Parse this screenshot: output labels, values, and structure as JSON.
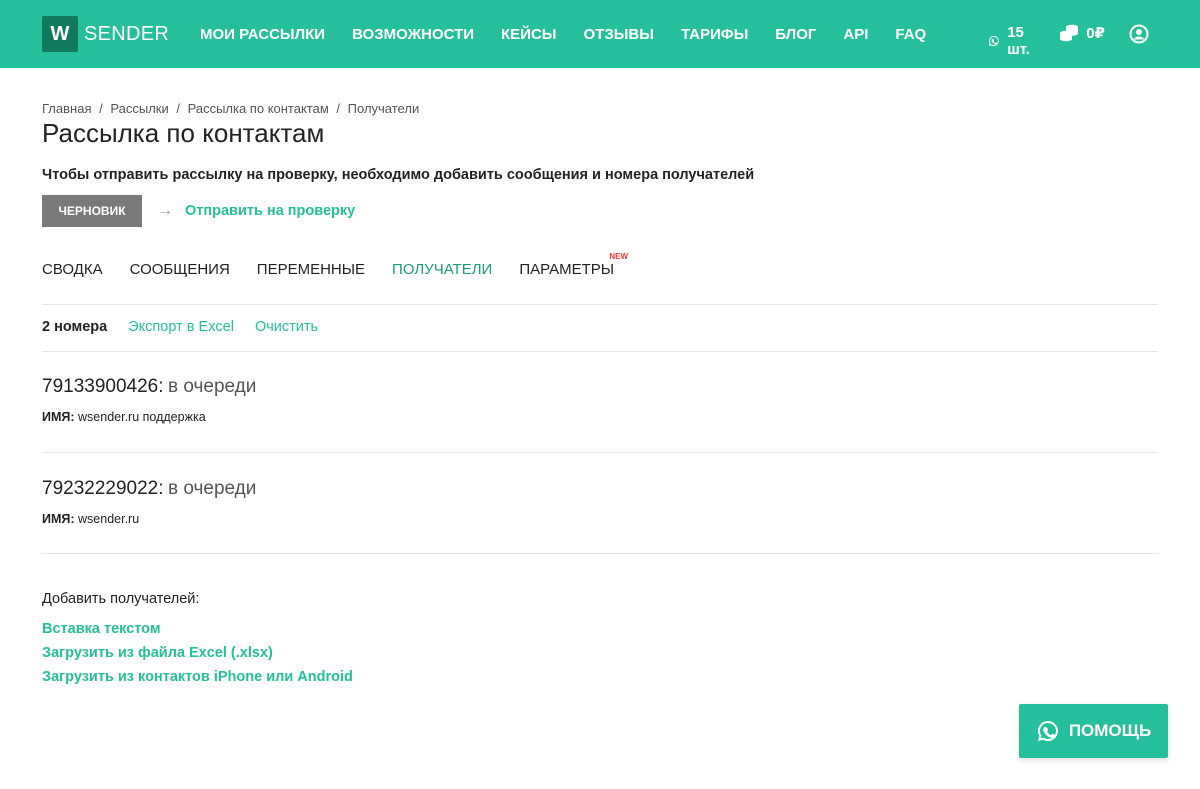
{
  "header": {
    "logo_letter": "W",
    "logo_text": "SENDER",
    "nav": [
      "МОИ РАССЫЛКИ",
      "ВОЗМОЖНОСТИ",
      "КЕЙСЫ",
      "ОТЗЫВЫ",
      "ТАРИФЫ",
      "БЛОГ",
      "API",
      "FAQ"
    ],
    "messages_count": "15 шт.",
    "balance": "0₽"
  },
  "breadcrumbs": [
    "Главная",
    "/",
    "Рассылки",
    "/",
    "Рассылка по контактам",
    "/",
    "Получатели"
  ],
  "page_title": "Рассылка по контактам",
  "notice": "Чтобы отправить рассылку на проверку, необходимо добавить сообщения и номера получателей",
  "status": {
    "draft_label": "ЧЕРНОВИК",
    "arrow": "→",
    "send_label": "Отправить на проверку"
  },
  "tabs": [
    {
      "label": "СВОДКА"
    },
    {
      "label": "СООБЩЕНИЯ"
    },
    {
      "label": "ПЕРЕМЕННЫЕ"
    },
    {
      "label": "ПОЛУЧАТЕЛИ"
    },
    {
      "label": "ПАРАМЕТРЫ",
      "badge": "NEW"
    }
  ],
  "recipients_bar": {
    "count": "2 номера",
    "export_label": "Экспорт в Excel",
    "clear_label": "Очистить"
  },
  "recipients": [
    {
      "number": "79133900426:",
      "status": "в очереди",
      "name_label": "ИМЯ:",
      "name": "wsender.ru поддержка"
    },
    {
      "number": "79232229022:",
      "status": "в очереди",
      "name_label": "ИМЯ:",
      "name": "wsender.ru"
    }
  ],
  "add": {
    "label": "Добавить получателей:",
    "links": [
      "Вставка текстом",
      "Загрузить из файла Excel (.xlsx)",
      "Загрузить из контактов iPhone или Android"
    ]
  },
  "help_label": "ПОМОЩЬ",
  "colors": {
    "brand": "#25bf9c",
    "logo_box": "#117a5e",
    "draft": "#7a7a7a",
    "badge": "#e53935"
  }
}
